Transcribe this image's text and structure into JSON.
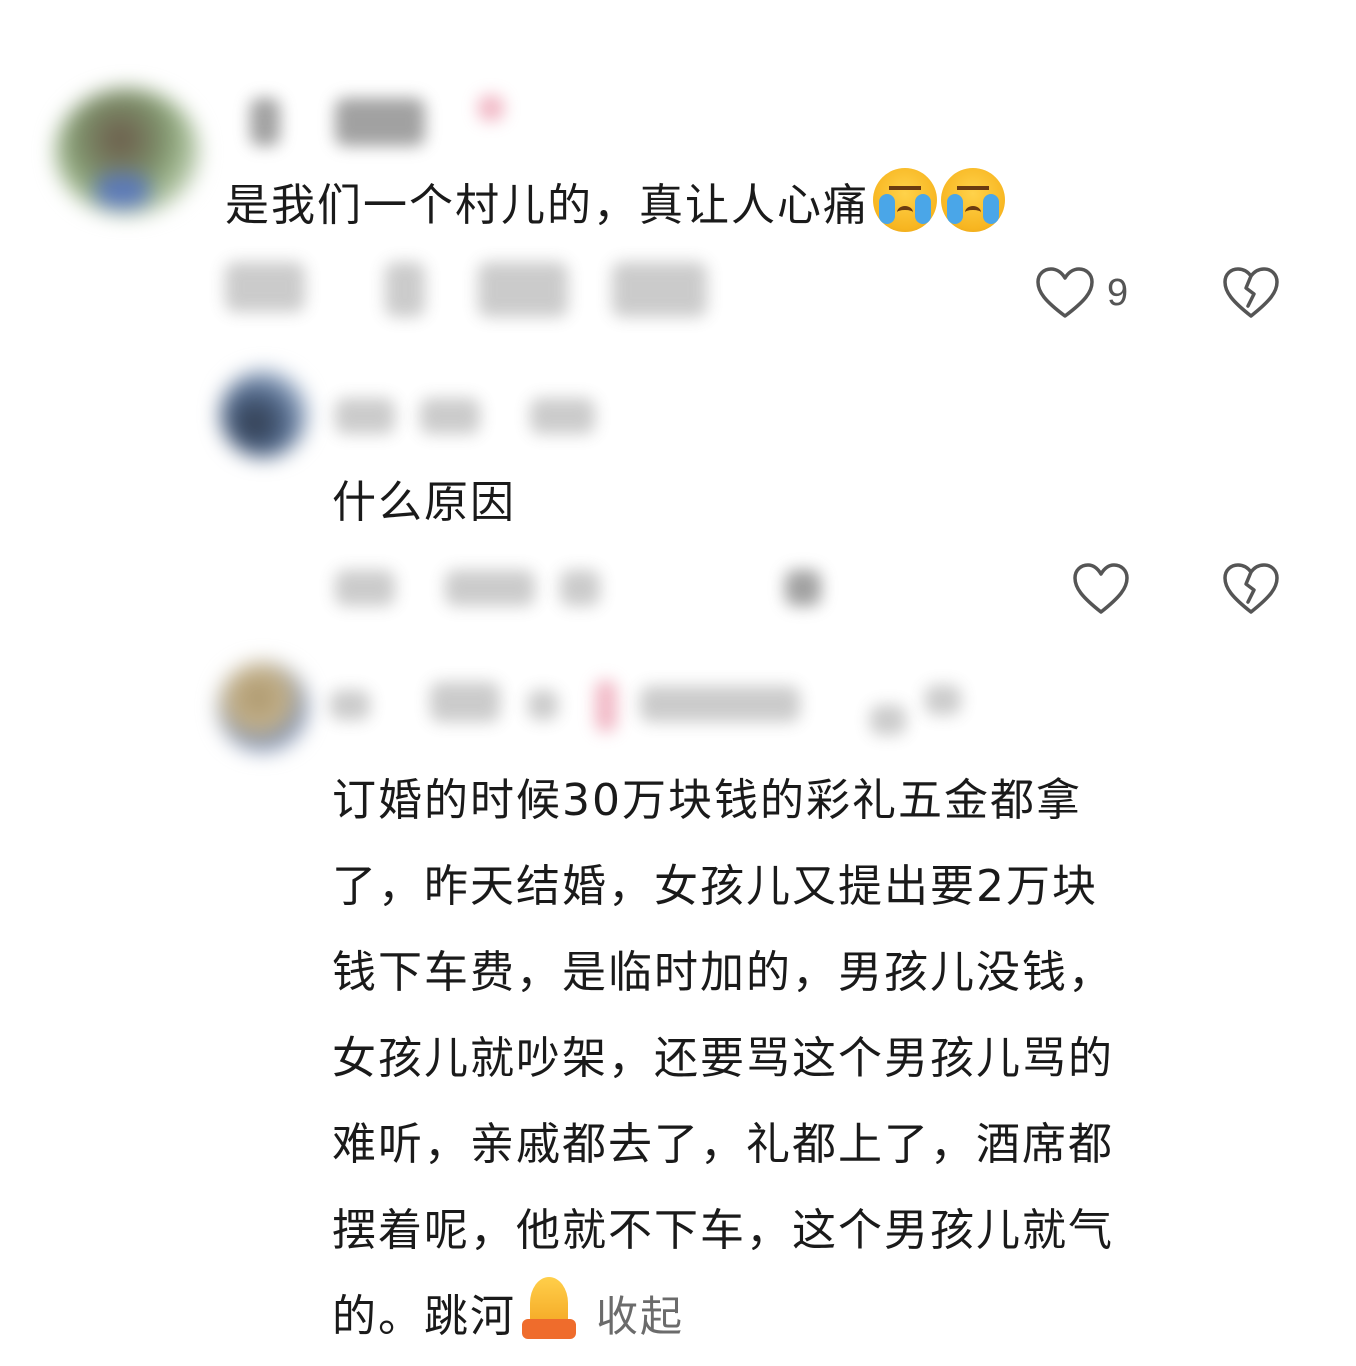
{
  "comments": [
    {
      "text": "是我们一个村儿的，真让人心痛",
      "emojis": [
        "loudly-crying-face",
        "loudly-crying-face"
      ],
      "like_count": "9"
    },
    {
      "text": "什么原因"
    },
    {
      "text": "订婚的时候30万块钱的彩礼五金都拿\n了，昨天结婚，女孩儿又提出要2万块\n钱下车费，是临时加的，男孩儿没钱，\n女孩儿就吵架，还要骂这个男孩儿骂的\n难听，亲戚都去了，礼都上了，酒席都\n摆着呢，他就不下车，这个男孩儿就气\n的。跳河",
      "emoji": "folded-hands",
      "collapse_label": "收起"
    }
  ],
  "colors": {
    "text": "#1a1a1a",
    "icon_stroke": "#555555",
    "muted": "#6b6b6b"
  }
}
